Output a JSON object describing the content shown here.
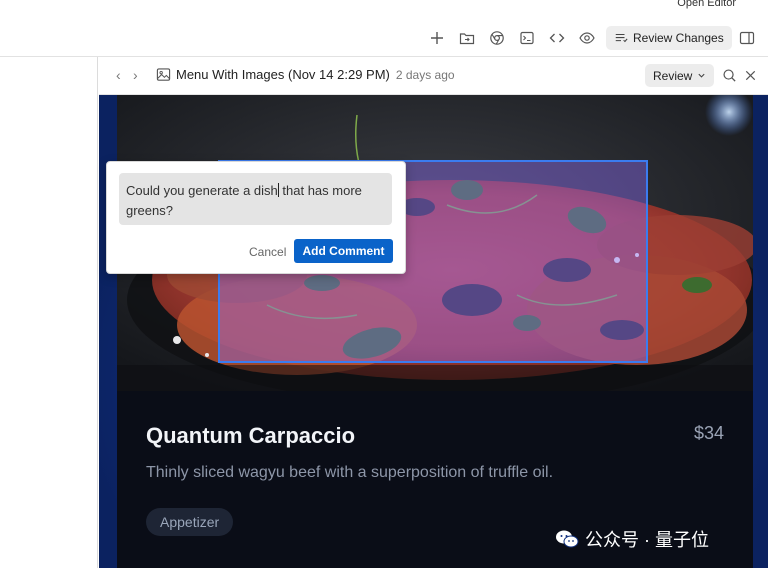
{
  "top_bar": {
    "open_editor_label": "Open Editor"
  },
  "toolbar": {
    "icons": [
      "plus-icon",
      "folder-move-icon",
      "chrome-icon",
      "terminal-icon",
      "code-icon",
      "eye-icon"
    ],
    "review_changes_label": "Review Changes"
  },
  "header": {
    "title": "Menu With Images (Nov 14 2:29 PM)",
    "subtitle": "2 days ago",
    "review_label": "Review"
  },
  "comment": {
    "text_before_cursor": "Could you generate a dish",
    "text_after_cursor": " that has more greens?",
    "cancel_label": "Cancel",
    "add_label": "Add Comment"
  },
  "card": {
    "name": "Quantum Carpaccio",
    "price": "$34",
    "description": "Thinly sliced wagyu beef with a superposition of truffle oil.",
    "tag": "Appetizer"
  },
  "watermark": {
    "text": "公众号 · 量子位"
  },
  "colors": {
    "accent": "#0a63c9",
    "selection_border": "#3b7cf0",
    "canvas_bg": "#0f2f7d",
    "card_bg": "#0a0d17"
  }
}
